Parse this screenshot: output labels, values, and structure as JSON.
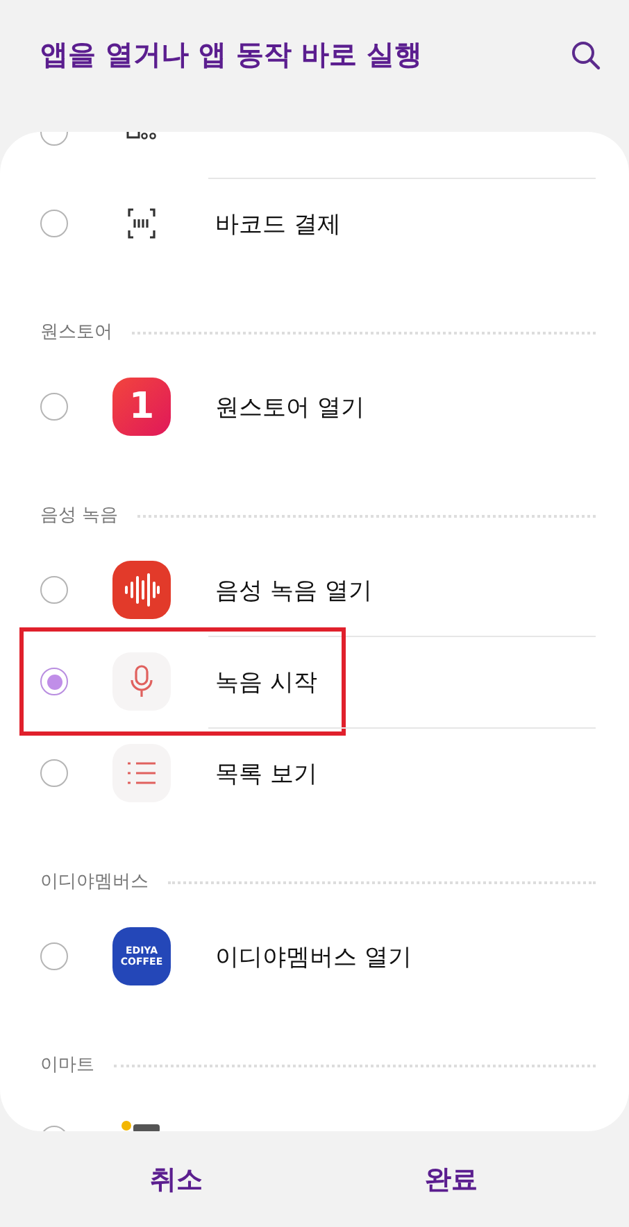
{
  "header": {
    "title": "앱을 열거나 앱 동작 바로 실행"
  },
  "groups": [
    {
      "items": [
        {
          "kind": "qr",
          "selected": false,
          "highlighted": false
        },
        {
          "kind": "barcode",
          "label": "바코드 결제",
          "selected": false,
          "highlighted": false
        }
      ]
    },
    {
      "label": "원스토어",
      "items": [
        {
          "kind": "onestore",
          "logo_text": [
            "1"
          ],
          "label": "원스토어 열기",
          "selected": false,
          "highlighted": false
        }
      ]
    },
    {
      "label": "음성 녹음",
      "items": [
        {
          "kind": "recorder",
          "label": "음성 녹음 열기",
          "selected": false,
          "highlighted": false
        },
        {
          "kind": "mic",
          "label": "녹음 시작",
          "selected": true,
          "highlighted": true
        },
        {
          "kind": "list",
          "label": "목록 보기",
          "selected": false,
          "highlighted": false
        }
      ]
    },
    {
      "label": "이디야멤버스",
      "items": [
        {
          "kind": "ediya",
          "logo_text": [
            "EDIYA",
            "COFFEE"
          ],
          "label": "이디야멤버스 열기",
          "selected": false,
          "highlighted": false
        }
      ]
    },
    {
      "label": "이마트",
      "items": [
        {
          "kind": "emart",
          "selected": false,
          "highlighted": false
        }
      ]
    }
  ],
  "footer": {
    "buttons": [
      "취소",
      "완료"
    ]
  }
}
